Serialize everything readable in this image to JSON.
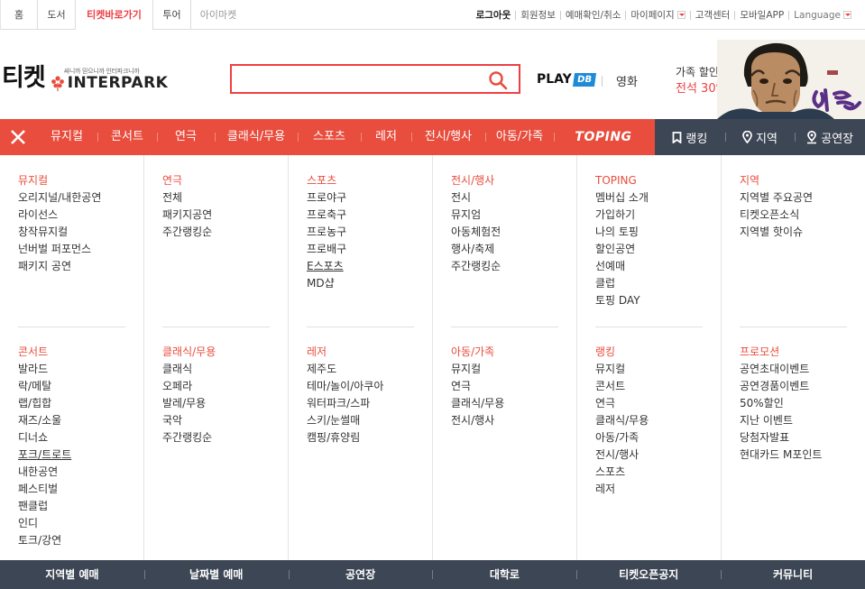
{
  "topbar": {
    "tabs": [
      {
        "label": "홈"
      },
      {
        "label": "도서"
      },
      {
        "label": "티켓바로가기"
      },
      {
        "label": "투어"
      },
      {
        "label": "아이마켓"
      }
    ],
    "util": {
      "logout": "로그아웃",
      "member_info": "회원정보",
      "reserve_check": "예매확인/취소",
      "mypage": "마이페이지",
      "customer_center": "고객센터",
      "mobile_app": "모바일APP",
      "language": "Language"
    }
  },
  "header": {
    "logo_text": "티켓",
    "slogan": "싸니까 믿으니까 인터파크니까",
    "brand": "INTERPARK",
    "search": {
      "value": "",
      "placeholder": ""
    },
    "playdb_play": "PLAY",
    "playdb_db": "DB",
    "movie": "영화",
    "promo_line1": "가족 할인",
    "promo_line2": "전석 30%",
    "poster_text": "영웅"
  },
  "nav": {
    "categories": [
      {
        "label": "뮤지컬"
      },
      {
        "label": "콘서트"
      },
      {
        "label": "연극"
      },
      {
        "label": "클래식/무용"
      },
      {
        "label": "스포츠"
      },
      {
        "label": "레저"
      },
      {
        "label": "전시/행사"
      },
      {
        "label": "아동/가족"
      },
      {
        "label": "TOPING"
      }
    ],
    "right": [
      {
        "label": "랭킹",
        "icon": "bookmark-icon"
      },
      {
        "label": "지역",
        "icon": "location-pin-icon"
      },
      {
        "label": "공연장",
        "icon": "venue-pin-icon"
      }
    ]
  },
  "menu": {
    "columns": [
      {
        "top": {
          "title": "뮤지컬",
          "items": [
            "오리지널/내한공연",
            "라이선스",
            "창작뮤지컬",
            "넌버벌 퍼포먼스",
            "패키지 공연"
          ]
        },
        "bottom": {
          "title": "콘서트",
          "items": [
            "발라드",
            "락/메탈",
            "랩/힙합",
            "재즈/소울",
            "디너쇼",
            "포크/트로트",
            "내한공연",
            "페스티벌",
            "팬클럽",
            "인디",
            "토크/강연"
          ]
        }
      },
      {
        "top": {
          "title": "연극",
          "items": [
            "전체",
            "패키지공연",
            "주간랭킹순"
          ]
        },
        "bottom": {
          "title": "클래식/무용",
          "items": [
            "클래식",
            "오페라",
            "발레/무용",
            "국악",
            "주간랭킹순"
          ]
        }
      },
      {
        "top": {
          "title": "스포츠",
          "items": [
            "프로야구",
            "프로축구",
            "프로농구",
            "프로배구",
            "E스포츠",
            "MD샵"
          ]
        },
        "bottom": {
          "title": "레저",
          "items": [
            "제주도",
            "테마/놀이/아쿠아",
            "워터파크/스파",
            "스키/눈썰매",
            "캠핑/휴양림"
          ]
        }
      },
      {
        "top": {
          "title": "전시/행사",
          "items": [
            "전시",
            "뮤지엄",
            "아동체험전",
            "행사/축제",
            "주간랭킹순"
          ]
        },
        "bottom": {
          "title": "아동/가족",
          "items": [
            "뮤지컬",
            "연극",
            "클래식/무용",
            "전시/행사"
          ]
        }
      },
      {
        "top": {
          "title": "TOPING",
          "items": [
            "멤버십 소개",
            "가입하기",
            "나의 토핑",
            "할인공연",
            "선예매",
            "클럽",
            "토핑 DAY"
          ]
        },
        "bottom": {
          "title": "랭킹",
          "items": [
            "뮤지컬",
            "콘서트",
            "연극",
            "클래식/무용",
            "아동/가족",
            "전시/행사",
            "스포츠",
            "레저"
          ]
        }
      },
      {
        "top": {
          "title": "지역",
          "items": [
            "지역별 주요공연",
            "티켓오픈소식",
            "지역별 핫이슈"
          ]
        },
        "bottom": {
          "title": "프로모션",
          "items": [
            "공연초대이벤트",
            "공연경품이벤트",
            "50%할인",
            "지난 이벤트",
            "당첨자발표",
            "현대카드 M포인트"
          ]
        }
      }
    ]
  },
  "bottom": {
    "items": [
      {
        "label": "지역별 예매"
      },
      {
        "label": "날짜별 예매"
      },
      {
        "label": "공연장"
      },
      {
        "label": "대학로"
      },
      {
        "label": "티켓오픈공지"
      },
      {
        "label": "커뮤니티"
      }
    ]
  },
  "colors": {
    "accent": "#e84d3d",
    "dark": "#3d4654",
    "playdb": "#1f8bd6"
  }
}
